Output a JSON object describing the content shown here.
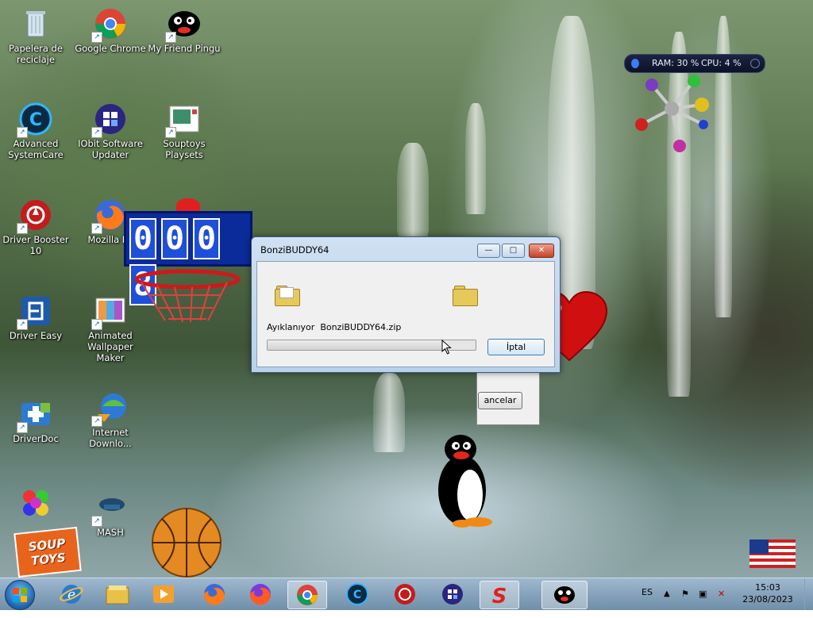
{
  "desktop_icons": [
    {
      "id": "recycle",
      "label": "Papelera de reciclaje",
      "icon": "recycle-bin-icon"
    },
    {
      "id": "chrome",
      "label": "Google Chrome",
      "icon": "chrome-icon"
    },
    {
      "id": "pingu",
      "label": "My Friend Pingu",
      "icon": "pingu-icon"
    },
    {
      "id": "asc",
      "label": "Advanced SystemCare",
      "icon": "advanced-systemcare-icon"
    },
    {
      "id": "iobit",
      "label": "IObit Software Updater",
      "icon": "iobit-updater-icon"
    },
    {
      "id": "souptoys-playsets",
      "label": "Souptoys Playsets",
      "icon": "souptoys-playsets-icon"
    },
    {
      "id": "driverbooster",
      "label": "Driver Booster 10",
      "icon": "driver-booster-icon"
    },
    {
      "id": "firefox",
      "label": "Mozilla Fir",
      "icon": "firefox-icon"
    },
    {
      "id": "drivereasy",
      "label": "Driver Easy",
      "icon": "driver-easy-icon"
    },
    {
      "id": "awm",
      "label": "Animated Wallpaper Maker",
      "icon": "wallpaper-maker-icon"
    },
    {
      "id": "driverdoc",
      "label": "DriverDoc",
      "icon": "driverdoc-icon"
    },
    {
      "id": "idm",
      "label": "Internet Downlo...",
      "icon": "internet-download-manager-icon"
    },
    {
      "id": "mash",
      "label": "MASH",
      "icon": "mash-icon"
    }
  ],
  "gadget": {
    "ram_label": "RAM: 30 %",
    "cpu_label": "CPU: 4 %"
  },
  "counter": {
    "digits": [
      "0",
      "0",
      "0",
      "8"
    ]
  },
  "background_dialog": {
    "button_label": "ancelar"
  },
  "dialog": {
    "title": "BonziBUDDY64",
    "status_prefix": "Ayıklanıyor",
    "filename": "BonziBUDDY64.zip",
    "progress": 0.85,
    "cancel_label": "İptal",
    "min_label": "—",
    "max_label": "□",
    "close_label": "✕"
  },
  "taskbar": {
    "items": [
      {
        "name": "ie-icon",
        "active": false
      },
      {
        "name": "file-explorer-icon",
        "active": false
      },
      {
        "name": "media-player-icon",
        "active": false
      },
      {
        "name": "firefox-icon",
        "active": false
      },
      {
        "name": "firefox-alt-icon",
        "active": false
      },
      {
        "name": "chrome-icon",
        "active": true
      },
      {
        "name": "advanced-systemcare-icon",
        "active": false
      },
      {
        "name": "driver-booster-icon",
        "active": false
      },
      {
        "name": "iobit-updater-icon",
        "active": false
      },
      {
        "name": "souptoys-icon",
        "active": true
      },
      {
        "name": "pingu-icon",
        "active": true
      }
    ],
    "language": "ES",
    "time": "15:03",
    "date": "23/08/2023"
  },
  "decor": {
    "souptoys_logo": "SOUP TOYS"
  }
}
